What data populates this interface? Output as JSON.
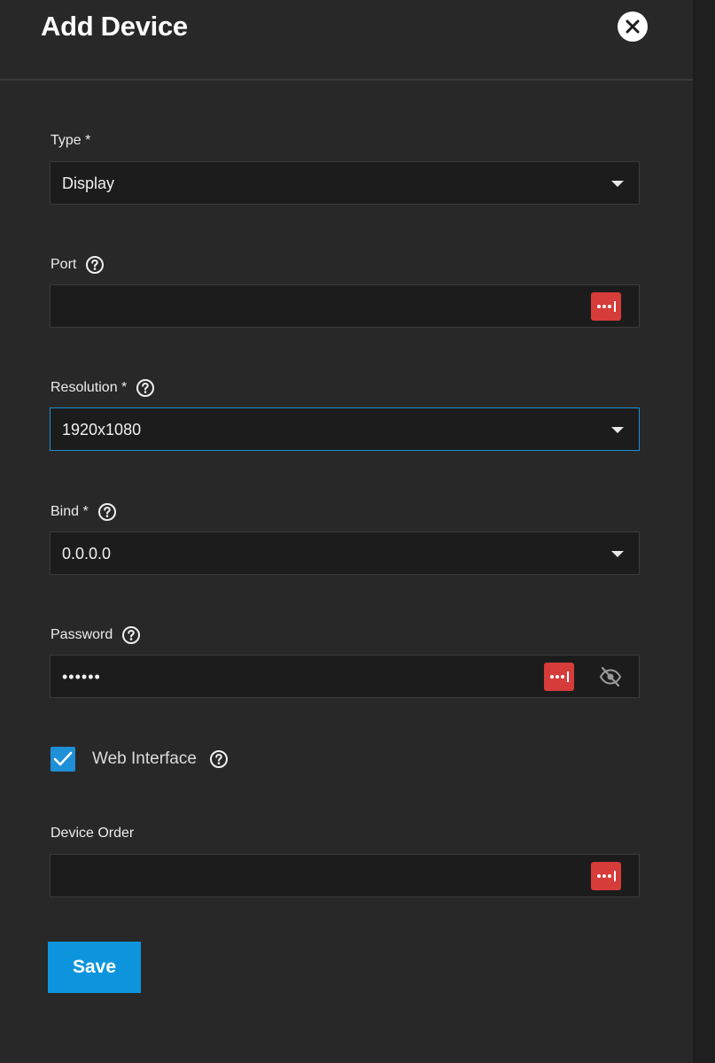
{
  "dialog": {
    "title": "Add Device"
  },
  "form": {
    "type": {
      "label": "Type *",
      "value": "Display"
    },
    "port": {
      "label": "Port",
      "value": ""
    },
    "resolution": {
      "label": "Resolution *",
      "value": "1920x1080"
    },
    "bind": {
      "label": "Bind *",
      "value": "0.0.0.0"
    },
    "password": {
      "label": "Password",
      "value": "••••••"
    },
    "web_interface": {
      "label": "Web Interface",
      "checked": true
    },
    "device_order": {
      "label": "Device Order",
      "value": ""
    }
  },
  "actions": {
    "save_label": "Save"
  },
  "colors": {
    "accent": "#0c95dd",
    "focus_border": "#1e8fd6",
    "password_manager": "#d63c3a",
    "background": "#282828"
  },
  "icons": [
    "close-icon",
    "help-icon",
    "password-manager-icon",
    "eye-off-icon",
    "checkmark-icon",
    "dropdown-caret-icon"
  ]
}
